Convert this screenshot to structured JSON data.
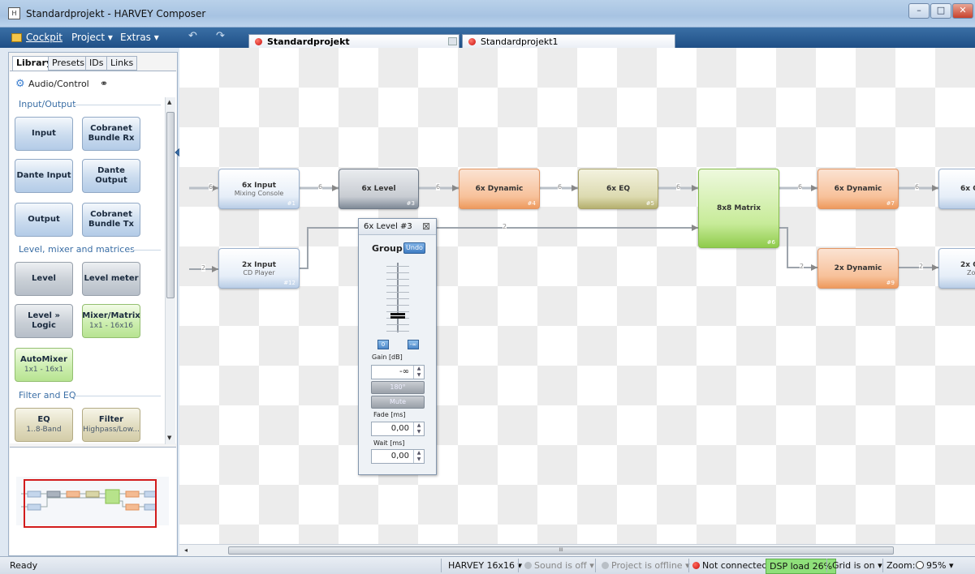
{
  "window": {
    "title": "Standardprojekt - HARVEY Composer",
    "icon_label": "H",
    "buttons": [
      "–",
      "□",
      "✕"
    ]
  },
  "menu": {
    "items": [
      "Cockpit",
      "Project",
      "Extras"
    ]
  },
  "tabs": [
    {
      "label": "Standardprojekt",
      "active": true
    },
    {
      "label": "Standardprojekt1",
      "active": false
    }
  ],
  "library": {
    "tabs": [
      "Library",
      "Presets",
      "IDs",
      "Links"
    ],
    "category": "Audio/Control",
    "link_glyph": "⚭",
    "sections": [
      {
        "label": "Input/Output",
        "blocks": [
          {
            "label": "Input",
            "sub": "",
            "color": "blue"
          },
          {
            "label": "Cobranet Bundle Rx",
            "sub": "",
            "color": "blue"
          },
          {
            "label": "Dante Input",
            "sub": "",
            "color": "blue"
          },
          {
            "label": "Dante Output",
            "sub": "",
            "color": "blue"
          },
          {
            "label": "Output",
            "sub": "",
            "color": "blue"
          },
          {
            "label": "Cobranet Bundle Tx",
            "sub": "",
            "color": "blue"
          }
        ]
      },
      {
        "label": "Level, mixer and matrices",
        "blocks": [
          {
            "label": "Level",
            "sub": "",
            "color": "grey"
          },
          {
            "label": "Level meter",
            "sub": "",
            "color": "grey"
          },
          {
            "label": "Level » Logic",
            "sub": "",
            "color": "grey"
          },
          {
            "label": "Mixer/Matrix",
            "sub": "1x1 - 16x16",
            "color": "green"
          },
          {
            "label": "AutoMixer",
            "sub": "1x1 - 16x1",
            "color": "green"
          }
        ]
      },
      {
        "label": "Filter and EQ",
        "blocks": [
          {
            "label": "EQ",
            "sub": "1..8-Band",
            "color": "tan"
          },
          {
            "label": "Filter",
            "sub": "Highpass/Low...",
            "color": "tan"
          }
        ]
      }
    ]
  },
  "canvas": {
    "nodes": [
      {
        "id": "n1",
        "label": "6x Input",
        "sub": "Mixing Console",
        "num": "#1",
        "color": "blue"
      },
      {
        "id": "n3",
        "label": "6x Level",
        "sub": "",
        "num": "#3",
        "color": "grey"
      },
      {
        "id": "n4",
        "label": "6x Dynamic",
        "sub": "",
        "num": "#4",
        "color": "orange"
      },
      {
        "id": "n5",
        "label": "6x EQ",
        "sub": "",
        "num": "#5",
        "color": "olive"
      },
      {
        "id": "n6",
        "label": "8x8 Matrix",
        "sub": "",
        "num": "#6",
        "color": "green"
      },
      {
        "id": "n7",
        "label": "6x Dynamic",
        "sub": "",
        "num": "#7",
        "color": "orange"
      },
      {
        "id": "n8",
        "label": "6x O",
        "sub": "",
        "num": "",
        "color": "blue"
      },
      {
        "id": "n12",
        "label": "2x Input",
        "sub": "CD Player",
        "num": "#12",
        "color": "blue"
      },
      {
        "id": "n9",
        "label": "2x Dynamic",
        "sub": "",
        "num": "#9",
        "color": "orange"
      },
      {
        "id": "n10",
        "label": "2x O",
        "sub": "Zo",
        "num": "",
        "color": "blue"
      }
    ],
    "wire_labels": {
      "six": "6",
      "two": "2"
    }
  },
  "popup": {
    "title": "6x Level #3",
    "close": "⊠",
    "group_label": "Group",
    "undo_label": "Undo",
    "fader_level": 0.2,
    "zero_button": "0",
    "neg_inf_button": "-∞",
    "gain_label": "Gain [dB]",
    "gain_value": "-∞",
    "phase_button": "180°",
    "mute_button": "Mute",
    "fade_label": "Fade [ms]",
    "fade_value": "0,00",
    "wait_label": "Wait [ms]",
    "wait_value": "0,00"
  },
  "scrollbar": {
    "grip": "III"
  },
  "status": {
    "ready": "Ready",
    "device": "HARVEY 16x16",
    "sound": "Sound is off",
    "project": "Project is offline",
    "connection": "Not connected",
    "dsp": "DSP load 26%",
    "grid": "Grid is on",
    "zoom_label": "Zoom:",
    "zoom_value": "95%"
  },
  "colors": {
    "accent": "#1f4f86",
    "status_red": "#cc1111",
    "dsp_green": "#8fe07a"
  }
}
